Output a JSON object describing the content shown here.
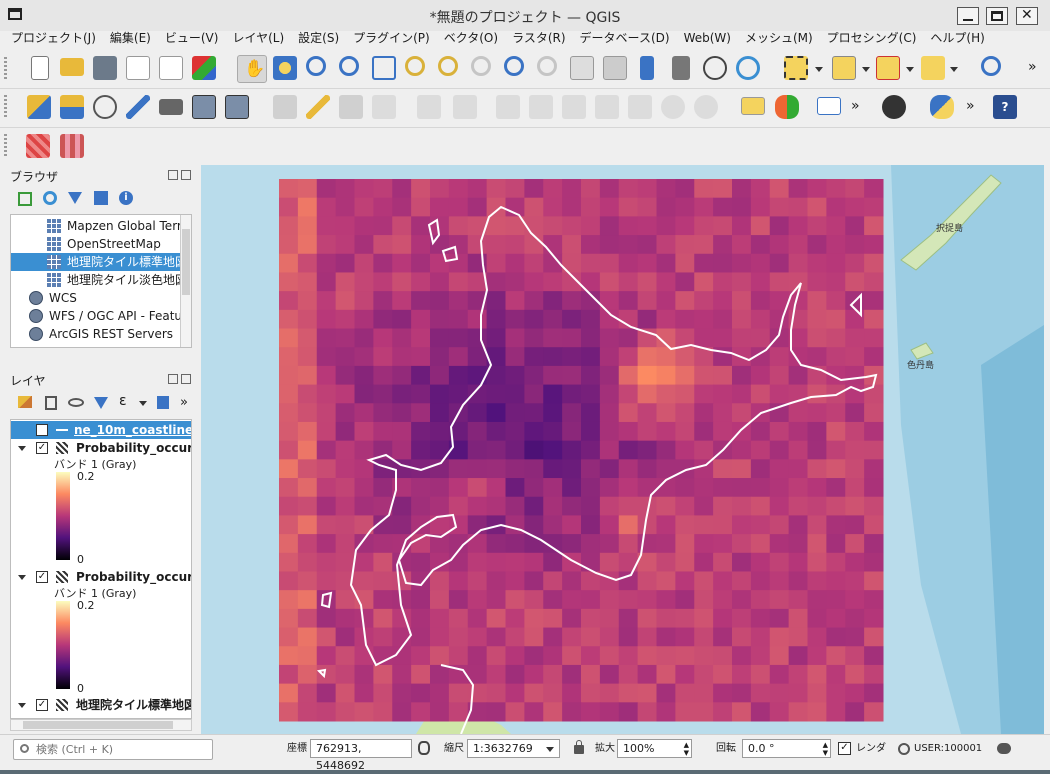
{
  "window": {
    "title": "*無題のプロジェクト — QGIS"
  },
  "menu": [
    "プロジェクト(J)",
    "編集(E)",
    "ビュー(V)",
    "レイヤ(L)",
    "設定(S)",
    "プラグイン(P)",
    "ベクタ(O)",
    "ラスタ(R)",
    "データベース(D)",
    "Web(W)",
    "メッシュ(M)",
    "プロセシング(C)",
    "ヘルプ(H)"
  ],
  "toolbar_more": "»",
  "browser": {
    "title": "ブラウザ",
    "items": [
      {
        "label": "Mapzen Global Terr",
        "icon": "xyz-tile-icon"
      },
      {
        "label": "OpenStreetMap",
        "icon": "xyz-tile-icon"
      },
      {
        "label": "地理院タイル標準地図",
        "icon": "xyz-tile-icon",
        "selected": true
      },
      {
        "label": "地理院タイル淡色地図",
        "icon": "xyz-tile-icon"
      },
      {
        "label": "WCS",
        "icon": "wcs-icon"
      },
      {
        "label": "WFS / OGC API - Featu",
        "icon": "wfs-icon"
      },
      {
        "label": "ArcGIS REST Servers",
        "icon": "arcgis-icon"
      }
    ]
  },
  "layers": {
    "title": "レイヤ",
    "items": [
      {
        "name": "ne_10m_coastline",
        "type": "vector-line",
        "checked": true,
        "selected": true
      },
      {
        "name": "Probability_occurren",
        "type": "raster",
        "checked": true,
        "band": "バンド 1 (Gray)",
        "max": "0.2",
        "min": "0"
      },
      {
        "name": "Probability_occurren",
        "type": "raster",
        "checked": true,
        "band": "バンド 1 (Gray)",
        "max": "0.2",
        "min": "0"
      },
      {
        "name": "地理院タイル標準地図",
        "type": "xyz",
        "checked": true
      }
    ]
  },
  "map": {
    "labels": {
      "island1": "択捉島",
      "island2": "色丹島"
    }
  },
  "status": {
    "search_placeholder": "検索 (Ctrl + K)",
    "coord_label": "座標",
    "coord_value": "762913, 5448692",
    "scale_label": "縮尺",
    "scale_value": "1:3632769",
    "magnifier_label": "拡大",
    "magnifier_value": "100%",
    "rotation_label": "回転",
    "rotation_value": "0.0 °",
    "render_label": "レンダ",
    "render_checked": true,
    "crs": "USER:100001"
  },
  "colors": {
    "selection": "#3a8fd2",
    "raster_ramp": [
      "#000004",
      "#51127c",
      "#b73779",
      "#fc8961",
      "#fcfdbf"
    ],
    "coastline": "#ffffff"
  }
}
